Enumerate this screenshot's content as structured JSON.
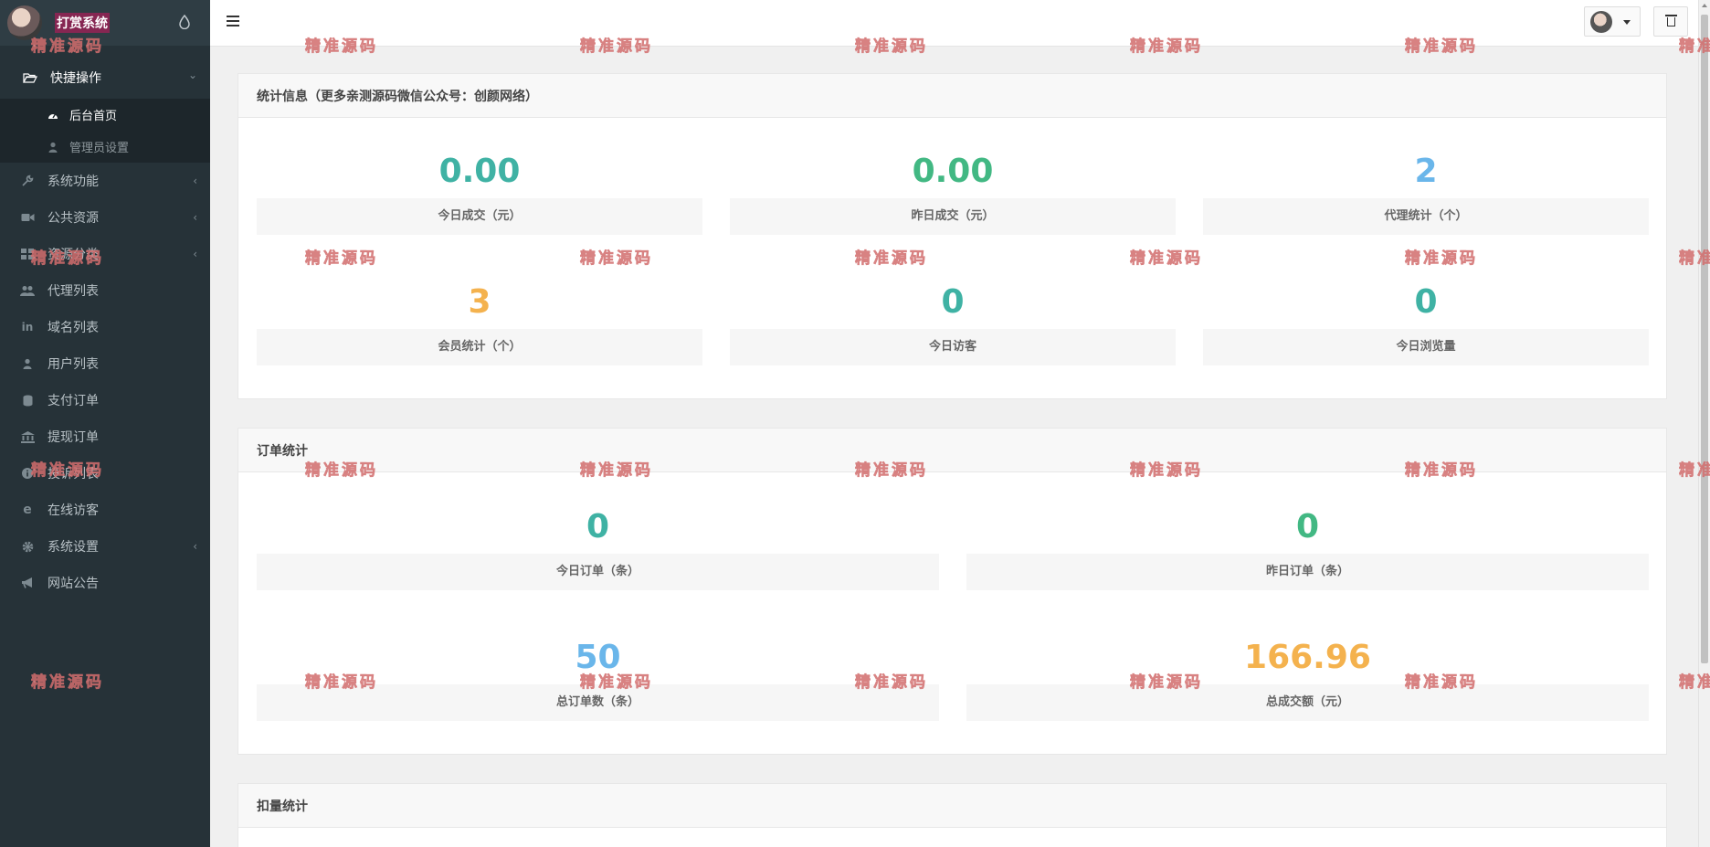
{
  "app": {
    "brand_title": "打赏系统"
  },
  "sidebar": {
    "items": [
      {
        "label": "快捷操作",
        "icon": "folder-open-icon",
        "expanded": true,
        "has_children": true
      },
      {
        "label": "系统功能",
        "icon": "wrench-icon",
        "has_children": true
      },
      {
        "label": "公共资源",
        "icon": "video-camera-icon",
        "has_children": true
      },
      {
        "label": "资源分类",
        "icon": "grid-icon",
        "has_children": true
      },
      {
        "label": "代理列表",
        "icon": "users-icon"
      },
      {
        "label": "域名列表",
        "icon": "linkedin-icon"
      },
      {
        "label": "用户列表",
        "icon": "user-icon"
      },
      {
        "label": "支付订单",
        "icon": "database-icon"
      },
      {
        "label": "提现订单",
        "icon": "bank-icon"
      },
      {
        "label": "投诉列表",
        "icon": "info-icon"
      },
      {
        "label": "在线访客",
        "icon": "ie-icon"
      },
      {
        "label": "系统设置",
        "icon": "gear-icon",
        "has_children": true
      },
      {
        "label": "网站公告",
        "icon": "bullhorn-icon"
      }
    ],
    "submenu": [
      {
        "label": "后台首页",
        "icon": "dashboard-icon",
        "current": true
      },
      {
        "label": "管理员设置",
        "icon": "user-icon"
      }
    ]
  },
  "panels": {
    "stats": {
      "title": "统计信息（更多亲测源码微信公众号：创颜网络）",
      "items": [
        {
          "value": "0.00",
          "label": "今日成交（元）",
          "color": "#3fb2a4"
        },
        {
          "value": "0.00",
          "label": "昨日成交（元）",
          "color": "#42b883"
        },
        {
          "value": "2",
          "label": "代理统计（个）",
          "color": "#6ab6ea"
        },
        {
          "value": "3",
          "label": "会员统计（个）",
          "color": "#f4b24e"
        },
        {
          "value": "0",
          "label": "今日访客",
          "color": "#3fb2a4"
        },
        {
          "value": "0",
          "label": "今日浏览量",
          "color": "#3fb2a4"
        }
      ]
    },
    "orders": {
      "title": "订单统计",
      "items": [
        {
          "value": "0",
          "label": "今日订单（条）",
          "color": "#3fb2a4"
        },
        {
          "value": "0",
          "label": "昨日订单（条）",
          "color": "#42b883"
        },
        {
          "value": "50",
          "label": "总订单数（条）",
          "color": "#6ab6ea"
        },
        {
          "value": "166.96",
          "label": "总成交额（元）",
          "color": "#f4b24e"
        }
      ]
    },
    "deduct": {
      "title": "扣量统计"
    }
  },
  "watermark": {
    "text": "精准源码"
  }
}
